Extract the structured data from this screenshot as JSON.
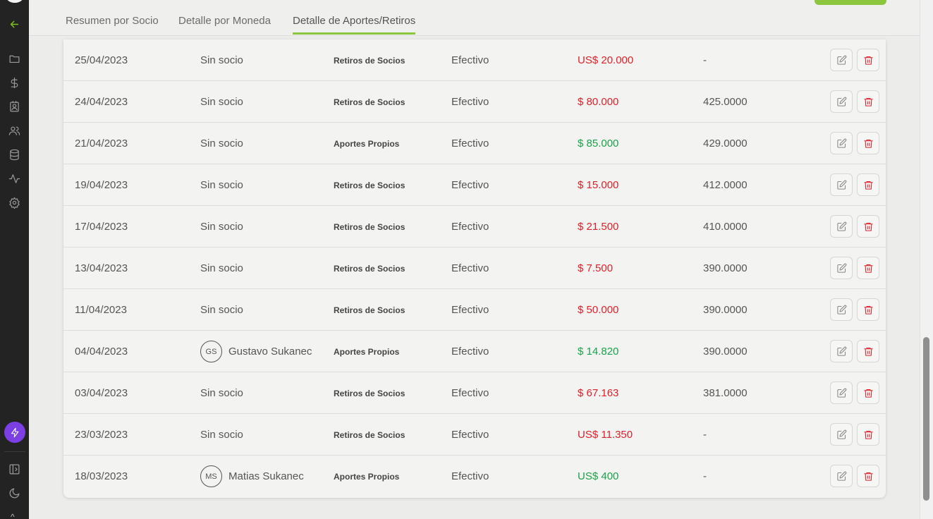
{
  "tabs": [
    {
      "label": "Resumen por Socio"
    },
    {
      "label": "Detalle por Moneda"
    },
    {
      "label": "Detalle de Aportes/Retiros"
    }
  ],
  "active_tab": 2,
  "accent_color": "#8cc63f",
  "negative_color": "#e0202a",
  "positive_color": "#1aa34a",
  "rows": [
    {
      "date": "25/04/2023",
      "socio": "Sin socio",
      "initials": "",
      "tipo": "Retiros de Socios",
      "medio": "Efectivo",
      "monto": "US$ 20.000",
      "sign": "neg",
      "cotizacion": "-"
    },
    {
      "date": "24/04/2023",
      "socio": "Sin socio",
      "initials": "",
      "tipo": "Retiros de Socios",
      "medio": "Efectivo",
      "monto": "$ 80.000",
      "sign": "neg",
      "cotizacion": "425.0000"
    },
    {
      "date": "21/04/2023",
      "socio": "Sin socio",
      "initials": "",
      "tipo": "Aportes Propios",
      "medio": "Efectivo",
      "monto": "$ 85.000",
      "sign": "pos",
      "cotizacion": "429.0000"
    },
    {
      "date": "19/04/2023",
      "socio": "Sin socio",
      "initials": "",
      "tipo": "Retiros de Socios",
      "medio": "Efectivo",
      "monto": "$ 15.000",
      "sign": "neg",
      "cotizacion": "412.0000"
    },
    {
      "date": "17/04/2023",
      "socio": "Sin socio",
      "initials": "",
      "tipo": "Retiros de Socios",
      "medio": "Efectivo",
      "monto": "$ 21.500",
      "sign": "neg",
      "cotizacion": "410.0000"
    },
    {
      "date": "13/04/2023",
      "socio": "Sin socio",
      "initials": "",
      "tipo": "Retiros de Socios",
      "medio": "Efectivo",
      "monto": "$ 7.500",
      "sign": "neg",
      "cotizacion": "390.0000"
    },
    {
      "date": "11/04/2023",
      "socio": "Sin socio",
      "initials": "",
      "tipo": "Retiros de Socios",
      "medio": "Efectivo",
      "monto": "$ 50.000",
      "sign": "neg",
      "cotizacion": "390.0000"
    },
    {
      "date": "04/04/2023",
      "socio": "Gustavo Sukanec",
      "initials": "GS",
      "tipo": "Aportes Propios",
      "medio": "Efectivo",
      "monto": "$ 14.820",
      "sign": "pos",
      "cotizacion": "390.0000"
    },
    {
      "date": "03/04/2023",
      "socio": "Sin socio",
      "initials": "",
      "tipo": "Retiros de Socios",
      "medio": "Efectivo",
      "monto": "$ 67.163",
      "sign": "neg",
      "cotizacion": "381.0000"
    },
    {
      "date": "23/03/2023",
      "socio": "Sin socio",
      "initials": "",
      "tipo": "Retiros de Socios",
      "medio": "Efectivo",
      "monto": "US$ 11.350",
      "sign": "neg",
      "cotizacion": "-"
    },
    {
      "date": "18/03/2023",
      "socio": "Matias Sukanec",
      "initials": "MS",
      "tipo": "Aportes Propios",
      "medio": "Efectivo",
      "monto": "US$ 400",
      "sign": "pos",
      "cotizacion": "-"
    }
  ],
  "sidebar": {
    "icons": [
      "back-arrow-icon",
      "folder-icon",
      "dollar-icon",
      "contact-card-icon",
      "users-icon",
      "database-icon",
      "activity-icon",
      "gear-icon",
      "lightning-icon",
      "sidebar-toggle-icon",
      "moon-icon"
    ]
  }
}
